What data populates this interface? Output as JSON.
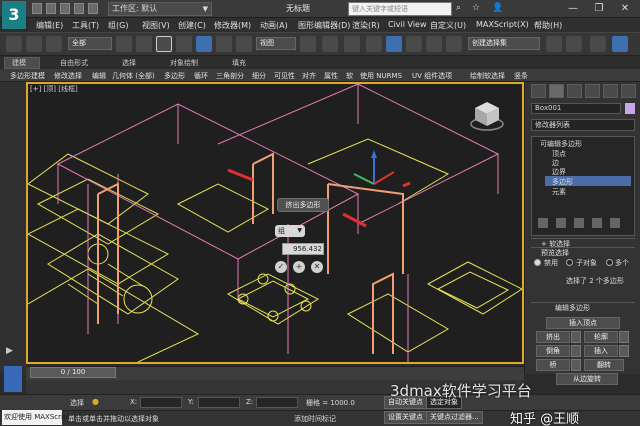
{
  "titlebar": {
    "workspace": "工作区: 默认",
    "doc_title": "无标题",
    "search_placeholder": "键入关键字或短语"
  },
  "menus": [
    "编辑(E)",
    "工具(T)",
    "组(G)",
    "视图(V)",
    "创建(C)",
    "修改器(M)",
    "动画(A)",
    "图形编辑器(D)",
    "渲染(R)",
    "Civil View",
    "自定义(U)",
    "MAXScript(X)",
    "帮助(H)"
  ],
  "toolbar": {
    "filter_value": "全部",
    "coord_system": "视图",
    "selection_set": "创建选择集"
  },
  "ribbon": {
    "tabs": [
      "建模",
      "自由形式",
      "选择",
      "对象绘制",
      "填充"
    ],
    "commands": [
      "多边形建模",
      "修改选择",
      "编辑",
      "几何体 (全部)",
      "多边形",
      "循环",
      "三角剖分",
      "细分",
      "可见性",
      "对齐",
      "属性",
      "软",
      "使用 NURMS",
      "UV 组件选项",
      "绘制软选择",
      "竖条"
    ]
  },
  "viewport": {
    "label": "[+] [顶] [线框]",
    "caddy_title": "挤出多边形",
    "caddy_mode": "组",
    "caddy_value": "956.432"
  },
  "panel": {
    "object_name": "Box001",
    "modifier_list": "修改器列表",
    "stack_items": [
      "可编辑多边形",
      "顶点",
      "边",
      "边界",
      "多边形",
      "元素"
    ],
    "soft_selection_title": "+ 软选择",
    "preview_title": "预览选择",
    "preview_options": [
      "禁用",
      "子对象",
      "多个"
    ],
    "selected_info": "选择了 2 个多边形",
    "edit_poly_title": "编辑多边形",
    "insert_vertex": "插入顶点",
    "buttons": [
      {
        "left": "挤出",
        "right": "轮廓"
      },
      {
        "left": "倒角",
        "right": "插入"
      },
      {
        "left": "桥",
        "right": "翻转"
      }
    ],
    "from_edge": "从边旋转"
  },
  "timeline": {
    "frame": "0 / 100"
  },
  "status": {
    "selected_label": "选择",
    "coord_x": "X:",
    "coord_y": "Y:",
    "coord_z": "Z:",
    "grid": "栅格 = 1000.0",
    "auto_key": "自动关键点",
    "selected_object": "选定对象",
    "set_key": "设置关键点",
    "key_filters": "关键点过滤器...",
    "welcome": "欢迎使用 MAXScript",
    "prompt": "单击或单击并拖动以选择对象",
    "add_time_tag": "添加时间标记"
  },
  "watermark": "3dmax软件学习平台",
  "watermark2": "知乎 @王顺",
  "colors": {
    "accent": "#e0a72a",
    "wire_yellow": "#e8e356",
    "wire_pink": "#e67bb4",
    "wire_orange": "#f0a070",
    "selection": "#4b6ea8"
  }
}
